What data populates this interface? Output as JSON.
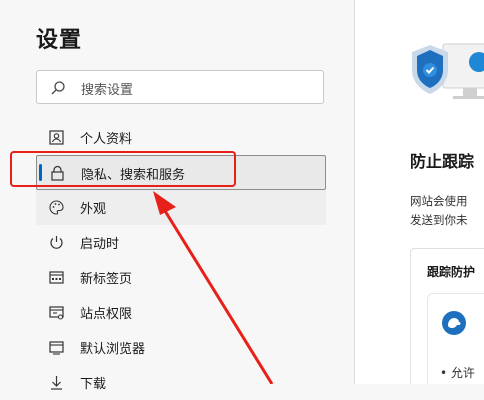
{
  "settings": {
    "title": "设置",
    "search_placeholder": "搜索设置",
    "nav": [
      {
        "label": "个人资料",
        "icon": "profile-icon"
      },
      {
        "label": "隐私、搜索和服务",
        "icon": "lock-icon",
        "active": true
      },
      {
        "label": "外观",
        "icon": "palette-icon"
      },
      {
        "label": "启动时",
        "icon": "power-icon"
      },
      {
        "label": "新标签页",
        "icon": "new-tab-icon"
      },
      {
        "label": "站点权限",
        "icon": "site-permissions-icon"
      },
      {
        "label": "默认浏览器",
        "icon": "browser-icon"
      },
      {
        "label": "下载",
        "icon": "download-icon"
      }
    ]
  },
  "main": {
    "heading": "防止跟踪",
    "description": [
      "网站会使用",
      "发送到你未"
    ],
    "card": {
      "title": "跟踪防护",
      "bullet": "• 允许"
    }
  },
  "annotation": {
    "color": "#e8201a"
  },
  "accent": "#0067c0"
}
